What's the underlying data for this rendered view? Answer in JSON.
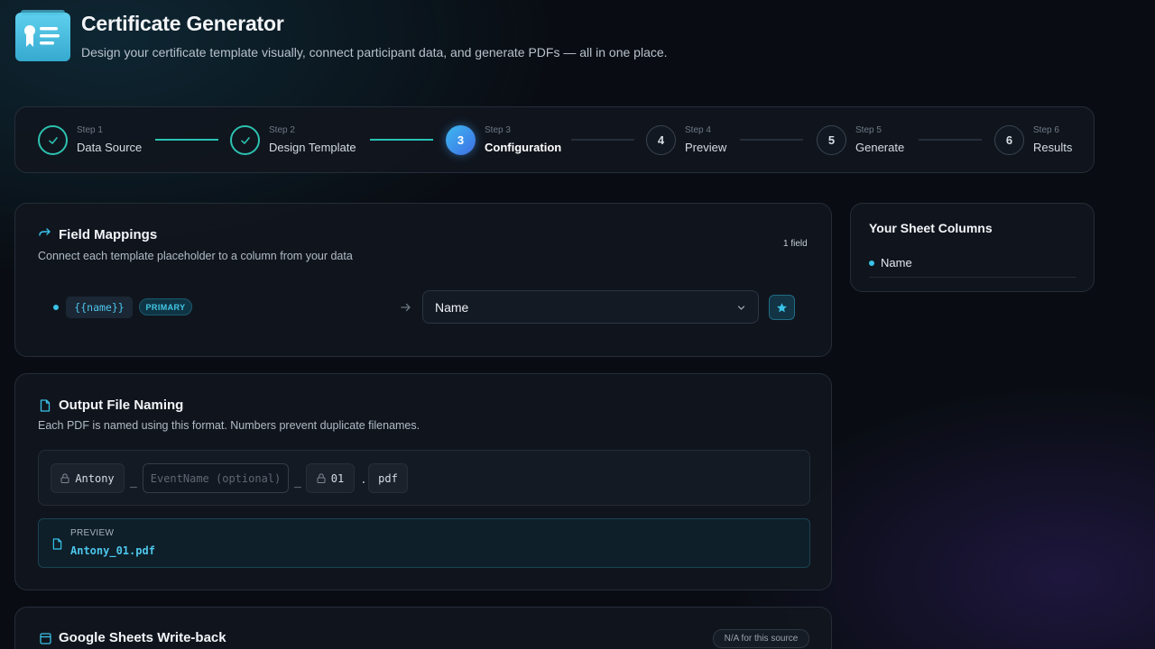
{
  "header": {
    "title": "Certificate Generator",
    "subtitle": "Design your certificate template visually, connect participant data, and generate PDFs — all in one place."
  },
  "stepper": {
    "steps": [
      {
        "step": "Step 1",
        "label": "Data Source",
        "state": "done"
      },
      {
        "step": "Step 2",
        "label": "Design Template",
        "state": "done"
      },
      {
        "step": "Step 3",
        "label": "Configuration",
        "number": "3",
        "state": "active"
      },
      {
        "step": "Step 4",
        "label": "Preview",
        "number": "4",
        "state": "todo"
      },
      {
        "step": "Step 5",
        "label": "Generate",
        "number": "5",
        "state": "todo"
      },
      {
        "step": "Step 6",
        "label": "Results",
        "number": "6",
        "state": "todo"
      }
    ]
  },
  "field_mappings": {
    "title": "Field Mappings",
    "description": "Connect each template placeholder to a column from your data",
    "count": "1 field",
    "rows": [
      {
        "placeholder": "{{name}}",
        "badge": "PRIMARY",
        "selected_column": "Name"
      }
    ]
  },
  "sheet_columns": {
    "title": "Your Sheet Columns",
    "columns": [
      "Name"
    ]
  },
  "output_naming": {
    "title": "Output File Naming",
    "description": "Each PDF is named using this format. Numbers prevent duplicate filenames.",
    "part_name": "Antony",
    "separator1": "_",
    "event_placeholder": "EventName (optional)",
    "separator2": "_",
    "part_number": "01",
    "dot": ".",
    "extension": "pdf",
    "preview_label": "PREVIEW",
    "preview_value": "Antony_01.pdf"
  },
  "write_back": {
    "title": "Google Sheets Write-back",
    "badge": "N/A for this source"
  },
  "colors": {
    "accent": "#39c2e8",
    "done": "#2cc1b0",
    "background": "#090d13"
  }
}
